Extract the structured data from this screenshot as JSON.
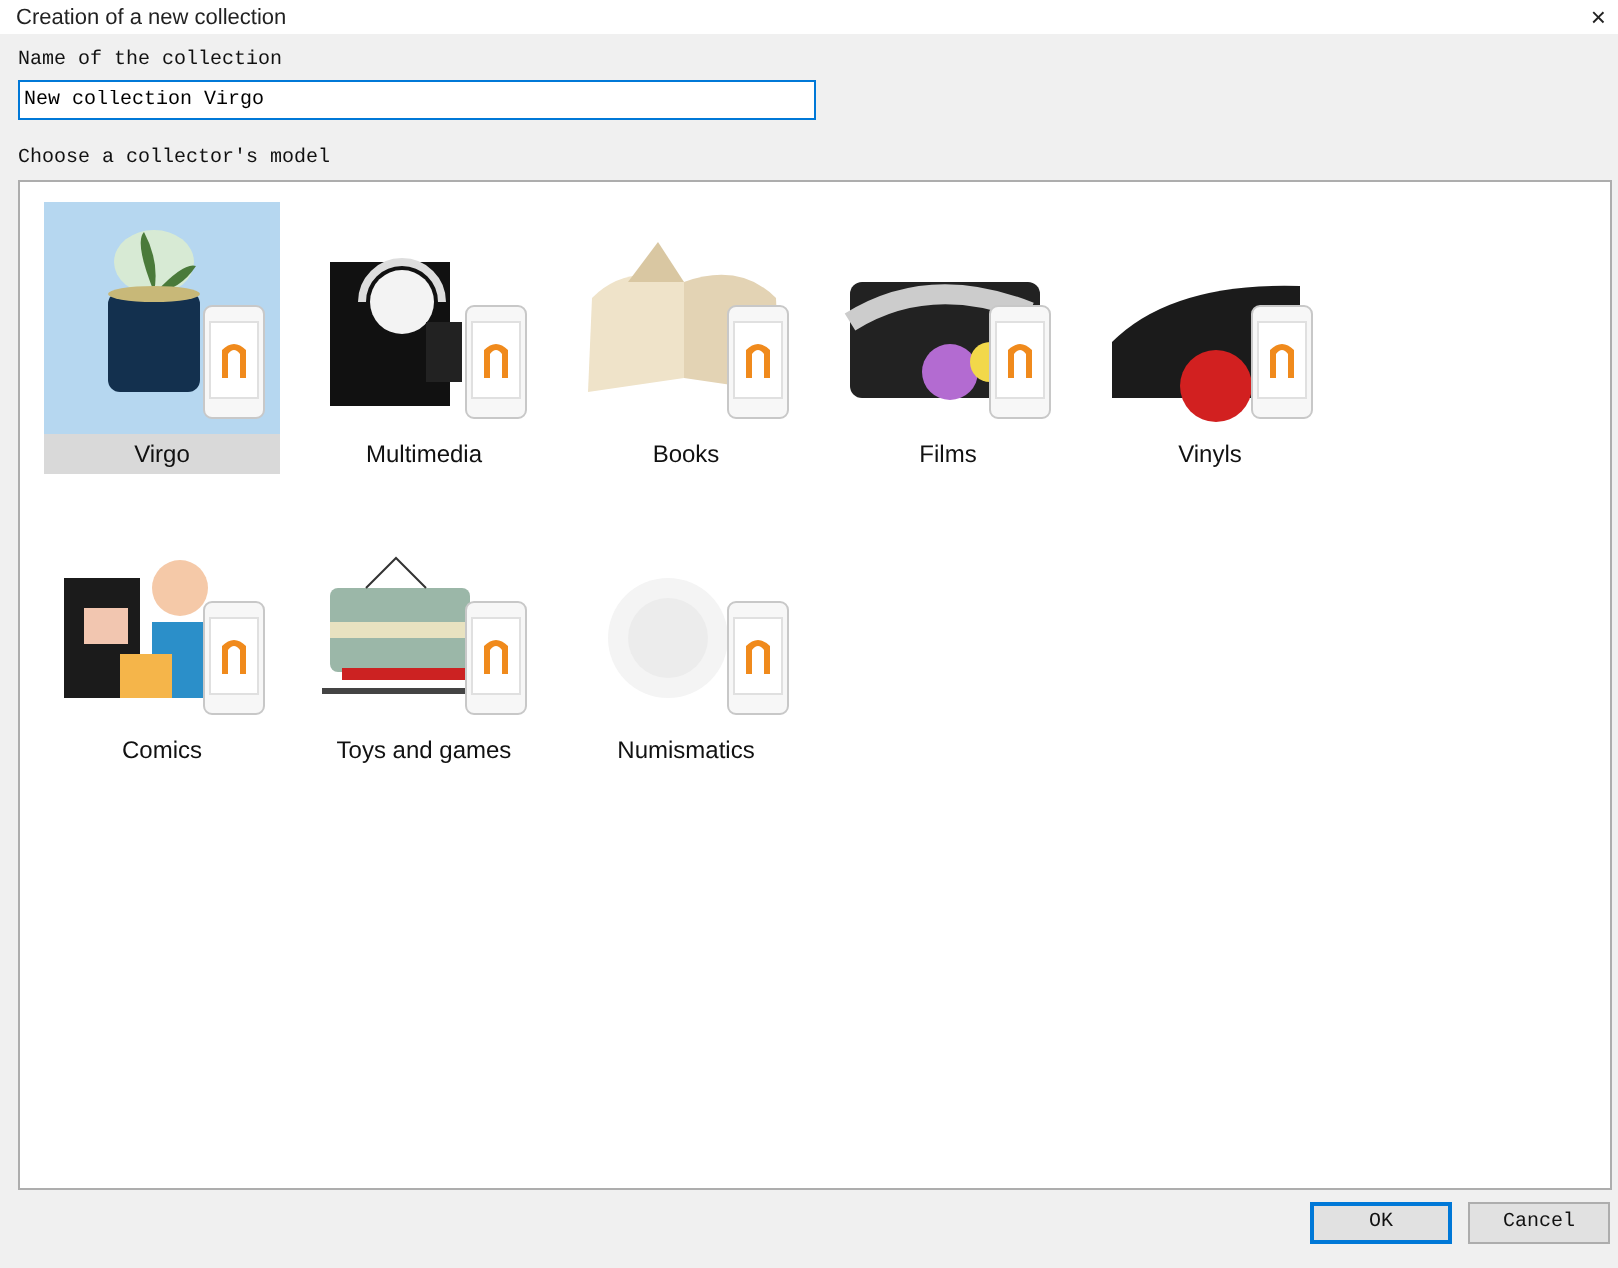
{
  "window": {
    "title": "Creation of a new collection",
    "close": "×"
  },
  "name_label": "Name of the collection",
  "name_field": {
    "value": "New collection Virgo"
  },
  "model_label": "Choose a collector's model",
  "models": [
    {
      "label": "Virgo",
      "selected": true
    },
    {
      "label": "Multimedia",
      "selected": false
    },
    {
      "label": "Books",
      "selected": false
    },
    {
      "label": "Films",
      "selected": false
    },
    {
      "label": "Vinyls",
      "selected": false
    },
    {
      "label": "Comics",
      "selected": false
    },
    {
      "label": "Toys and games",
      "selected": false
    },
    {
      "label": "Numismatics",
      "selected": false
    }
  ],
  "buttons": [
    {
      "label": "OK",
      "default": true
    },
    {
      "label": "Cancel",
      "default": false
    }
  ]
}
